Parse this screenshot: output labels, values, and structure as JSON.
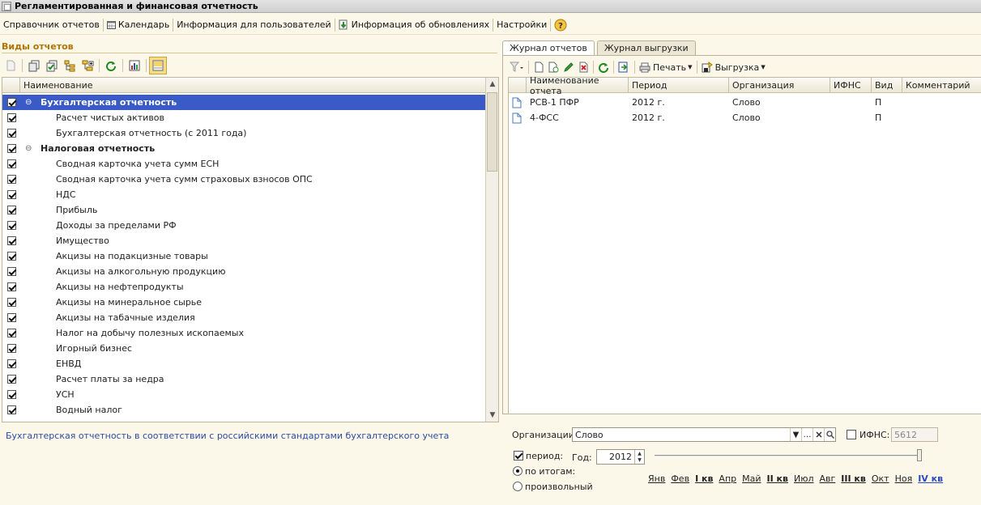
{
  "window": {
    "title": "Регламентированная и финансовая отчетность"
  },
  "menu": [
    {
      "label": "Справочник отчетов",
      "icon": "none"
    },
    {
      "label": "Календарь",
      "icon": "calendar-icon"
    },
    {
      "label": "Информация для пользователей",
      "icon": "none"
    },
    {
      "label": "Информация об обновлениях",
      "icon": "update-download-icon"
    },
    {
      "label": "Настройки",
      "icon": "none"
    }
  ],
  "left": {
    "title": "Виды отчетов",
    "column_header": "Наименование",
    "rows": [
      {
        "type": "group",
        "label": "Бухгалтерская отчетность",
        "checked": true,
        "selected": true
      },
      {
        "type": "item",
        "label": "Расчет чистых активов",
        "checked": true
      },
      {
        "type": "item",
        "label": "Бухгалтерская отчетность (с 2011 года)",
        "checked": true
      },
      {
        "type": "group",
        "label": "Налоговая отчетность",
        "checked": true
      },
      {
        "type": "item",
        "label": "Сводная карточка учета сумм ЕСН",
        "checked": true
      },
      {
        "type": "item",
        "label": "Сводная карточка учета сумм страховых взносов ОПС",
        "checked": true
      },
      {
        "type": "item",
        "label": "НДС",
        "checked": true
      },
      {
        "type": "item",
        "label": "Прибыль",
        "checked": true
      },
      {
        "type": "item",
        "label": "Доходы за пределами РФ",
        "checked": true
      },
      {
        "type": "item",
        "label": "Имущество",
        "checked": true
      },
      {
        "type": "item",
        "label": "Акцизы на подакцизные товары",
        "checked": true
      },
      {
        "type": "item",
        "label": "Акцизы на алкогольную продукцию",
        "checked": true
      },
      {
        "type": "item",
        "label": "Акцизы на нефтепродукты",
        "checked": true
      },
      {
        "type": "item",
        "label": "Акцизы на минеральное сырье",
        "checked": true
      },
      {
        "type": "item",
        "label": "Акцизы на табачные изделия",
        "checked": true
      },
      {
        "type": "item",
        "label": "Налог на добычу полезных ископаемых",
        "checked": true
      },
      {
        "type": "item",
        "label": "Игорный бизнес",
        "checked": true
      },
      {
        "type": "item",
        "label": "ЕНВД",
        "checked": true
      },
      {
        "type": "item",
        "label": "Расчет платы за недра",
        "checked": true
      },
      {
        "type": "item",
        "label": "УСН",
        "checked": true
      },
      {
        "type": "item",
        "label": "Водный налог",
        "checked": true
      }
    ],
    "description": "Бухгалтерская отчетность в соответствии с российскими стандартами бухгалтерского учета"
  },
  "right": {
    "tabs": [
      "Журнал отчетов",
      "Журнал выгрузки"
    ],
    "toolbar": {
      "print_label": "Печать",
      "export_label": "Выгрузка"
    },
    "columns": [
      "Наименование отчета",
      "Период",
      "Организация",
      "ИФНС",
      "Вид",
      "Комментарий"
    ],
    "rows": [
      {
        "name": "РСВ-1 ПФР",
        "period": "2012 г.",
        "org": "Слово",
        "ifns": "",
        "kind": "П",
        "comment": ""
      },
      {
        "name": "4-ФСС",
        "period": "2012 г.",
        "org": "Слово",
        "ifns": "",
        "kind": "П",
        "comment": ""
      }
    ]
  },
  "filters": {
    "org_label": "Организации:",
    "org_value": "Слово",
    "ifns_label": "ИФНС:",
    "ifns_value": "5612",
    "period_label": "период:",
    "period_checked": true,
    "year_label": "Год:",
    "year_value": "2012",
    "by_totals_label": "по итогам:",
    "arbitrary_label": "произвольный",
    "months": [
      "Янв",
      "Фев",
      "I кв",
      "Апр",
      "Май",
      "II кв",
      "Июл",
      "Авг",
      "III кв",
      "Окт",
      "Ноя",
      "IV кв"
    ]
  },
  "colors": {
    "selection": "#3a5bc7",
    "group_title": "#b07400",
    "link_blue": "#2a49c2"
  }
}
